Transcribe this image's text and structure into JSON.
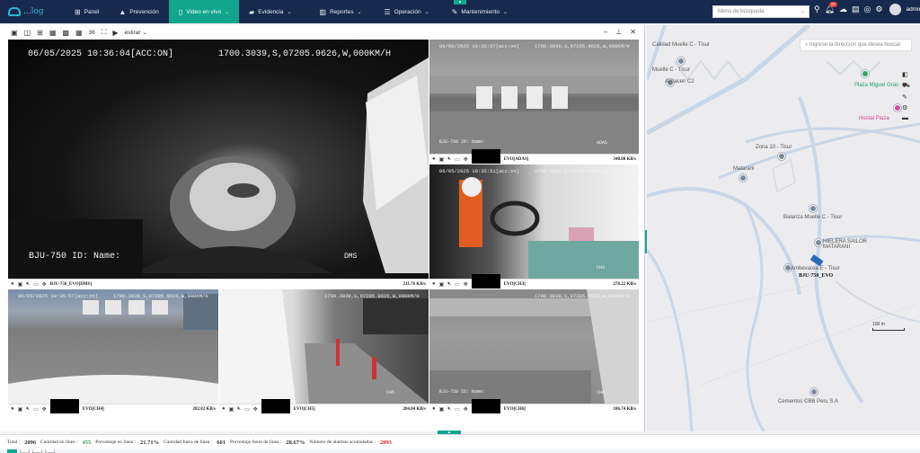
{
  "header": {
    "logo_text_a": "...",
    "logo_text_b": "log",
    "nav": [
      {
        "label": "Panel",
        "icon": "grid-icon",
        "active": false
      },
      {
        "label": "Prevención",
        "icon": "warning-icon",
        "active": false
      },
      {
        "label": "Video en vivo",
        "icon": "phone-icon",
        "active": true
      },
      {
        "label": "Evidencia",
        "icon": "folder-icon",
        "active": false
      },
      {
        "label": "Reportes",
        "icon": "chart-icon",
        "active": false
      },
      {
        "label": "Operación",
        "icon": "list-icon",
        "active": false
      },
      {
        "label": "Mantenimiento",
        "icon": "wrench-icon",
        "active": false
      }
    ],
    "search_placeholder": "Menú de búsqueda",
    "alarm_badge": "33",
    "user": "admin"
  },
  "video": {
    "toolbar_count": "36",
    "toolbar_label": "estirar",
    "tiles": [
      {
        "id": "dms",
        "timestamp": "06/05/2025 10:36:04[ACC:ON]",
        "coords": "1700.3039,S,07205.9626,W,000KM/H",
        "id_line": "BJU-750 ID: Name:",
        "tag": "DMS",
        "label": "BJU-750_EVO[DMS]",
        "rate": "211.76 KB/s"
      },
      {
        "id": "adas",
        "timestamp": "06/05/2025 10:35:57[acc:on]",
        "coords": "1700.3039,S,07205.9626,W,000KM/H",
        "id_line": "BJU-750 ID: Name:",
        "tag": "ADAS",
        "label": "EVO[ADAS]",
        "rate": "348.88 KB/s"
      },
      {
        "id": "ch3",
        "timestamp": "06/05/2025 10:35:51[acc:on]",
        "coords": "1700.3039,S,07205.9626,W,000KM/H",
        "id_line": "",
        "tag": "CH3",
        "label": "EVO[CH3]",
        "rate": "278.22 KB/s"
      },
      {
        "id": "ch4",
        "timestamp": "06/05/2025 10:35:57[acc:on]",
        "coords": "1700.3039,S,07205.9626,W,000KM/H",
        "id_line": "BJU-750 ID: Name:",
        "tag": "CH4",
        "label": "EVO[CH4]",
        "rate": "282.02 KB/s"
      },
      {
        "id": "ch5",
        "timestamp": "06/05/2025 10:36:00",
        "coords": "1700.3039,S,07205.9626,W,000KM/H",
        "id_line": "BJU-750 ID: Name:",
        "tag": "CH5",
        "label": "EVO[CH5]",
        "rate": "204.84 KB/s"
      },
      {
        "id": "ch6",
        "timestamp": "",
        "coords": "1700.3039,S,07205.9626,W,000KM/H",
        "id_line": "BJU-750 ID: Name:",
        "tag": "CH6",
        "label": "EVO[CH6]",
        "rate": "186.74 KB/s"
      }
    ],
    "pages": [
      "1",
      "2",
      "3",
      "+"
    ]
  },
  "map": {
    "address_placeholder": "Ingrese la dirección que desea buscar",
    "labels": [
      {
        "text": "Calidad Muelle C - Tisur",
        "kind": "gray"
      },
      {
        "text": "Muelle C - Tisur",
        "kind": "gray"
      },
      {
        "text": "Almacen C2",
        "kind": "gray"
      },
      {
        "text": "Plaza Miguel Grau",
        "kind": "green"
      },
      {
        "text": "Hostal Plaza",
        "kind": "pink"
      },
      {
        "text": "Zona 10 - Tisur",
        "kind": "gray"
      },
      {
        "text": "Matarani",
        "kind": "gray"
      },
      {
        "text": "Balanza Muelle C - Tisur",
        "kind": "gray"
      },
      {
        "text": "HIELERA SAILOR MATARANI",
        "kind": "gray"
      },
      {
        "text": "Ambevarea E - Tisur",
        "kind": "gray"
      },
      {
        "text": "Cementos CBB Peru S.A",
        "kind": "gray"
      }
    ],
    "vehicle_label": "BJU-750_EVO",
    "scale": "100 m"
  },
  "status": {
    "total_label": "Total :",
    "total": "2096",
    "online_label": "Cantidad en línea :",
    "online": "455",
    "online_pct_label": "Porcentaje en línea :",
    "online_pct": "21.71%",
    "offline_label": "Cantidad fuera de línea :",
    "offline": "601",
    "offline_pct_label": "Porcentaje fuera de línea :",
    "offline_pct": "28.67%",
    "alarms_label": "Número de alarmas acumuladas :",
    "alarms": "2093"
  },
  "colors": {
    "nav_bg": "#172a4d",
    "accent": "#11a58b",
    "alarm": "#d9222a",
    "online": "#2a9d4f"
  }
}
